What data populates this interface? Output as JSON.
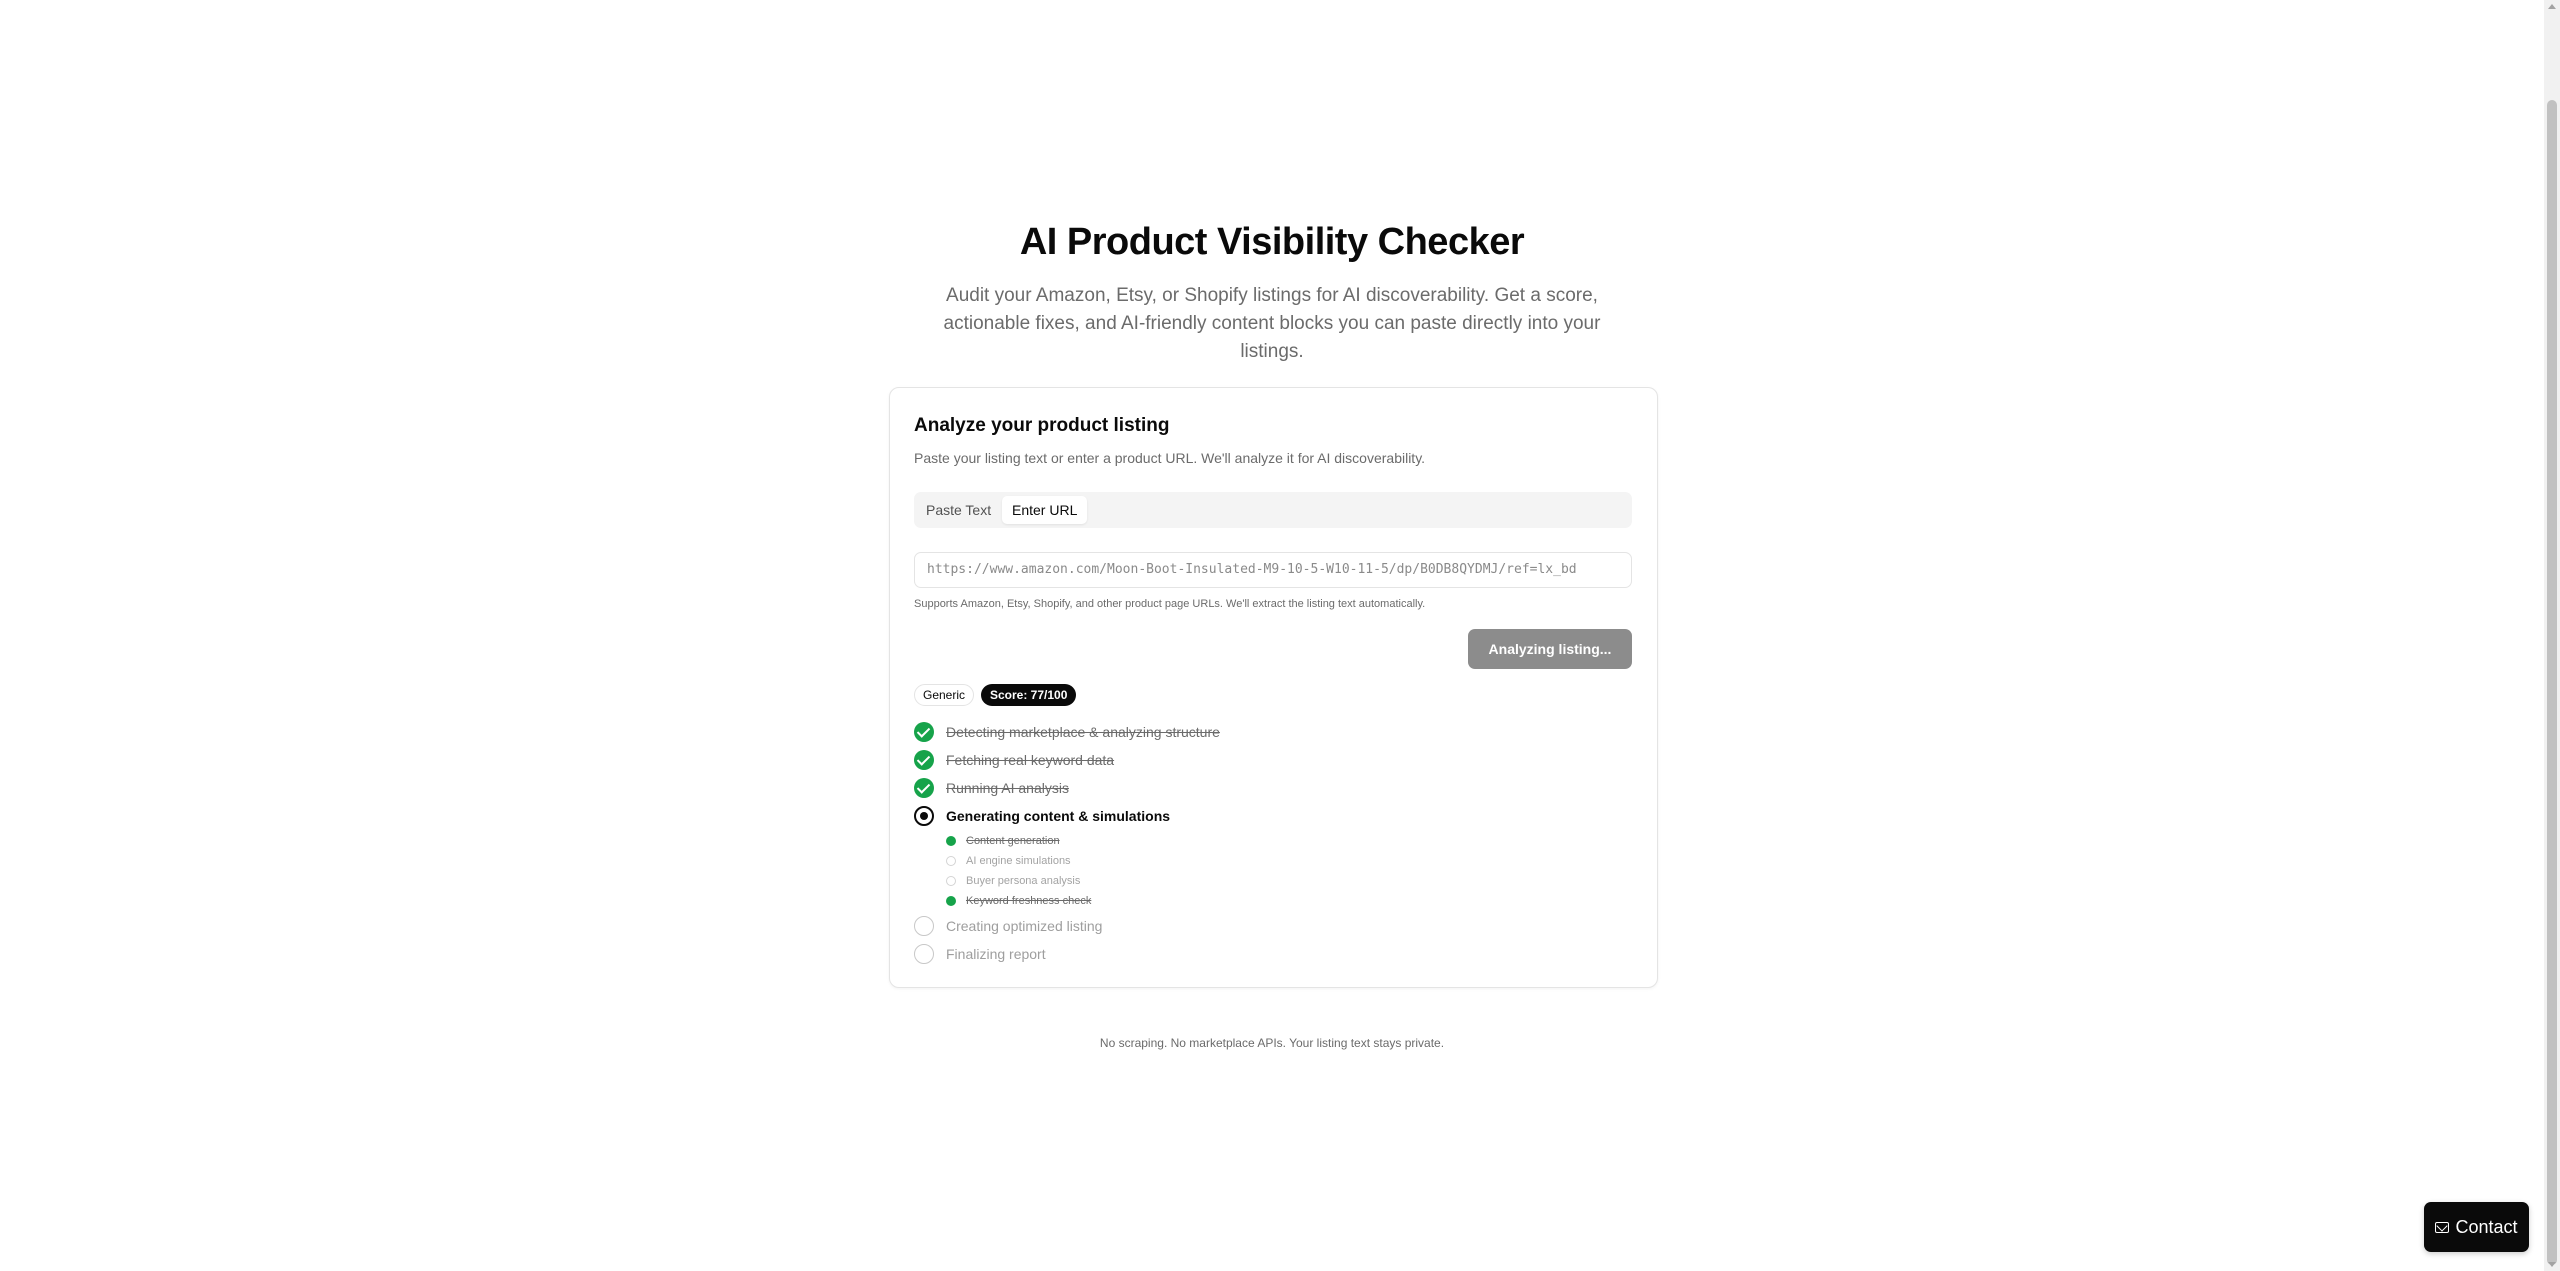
{
  "hero": {
    "title": "AI Product Visibility Checker",
    "subtitle": "Audit your Amazon, Etsy, or Shopify listings for AI discoverability. Get a score, actionable fixes, and AI-friendly content blocks you can paste directly into your listings."
  },
  "card": {
    "title": "Analyze your product listing",
    "description": "Paste your listing text or enter a product URL. We'll analyze it for AI discoverability.",
    "tabs": [
      {
        "label": "Paste Text",
        "active": false
      },
      {
        "label": "Enter URL",
        "active": true
      }
    ],
    "url_value": "https://www.amazon.com/Moon-Boot-Insulated-M9-10-5-W10-11-5/dp/B0DB8QYDMJ/ref=lx_bd",
    "helper": "Supports Amazon, Etsy, Shopify, and other product page URLs. We'll extract the listing text automatically.",
    "analyze_label": "Analyzing listing...",
    "badge_generic": "Generic",
    "badge_score": "Score: 77/100",
    "steps": [
      {
        "label": "Detecting marketplace & analyzing structure",
        "state": "done"
      },
      {
        "label": "Fetching real keyword data",
        "state": "done"
      },
      {
        "label": "Running AI analysis",
        "state": "done"
      },
      {
        "label": "Generating content & simulations",
        "state": "active"
      },
      {
        "label": "Creating optimized listing",
        "state": "pending"
      },
      {
        "label": "Finalizing report",
        "state": "pending"
      }
    ],
    "substeps": [
      {
        "label": "Content generation",
        "state": "done"
      },
      {
        "label": "AI engine simulations",
        "state": "pending"
      },
      {
        "label": "Buyer persona analysis",
        "state": "pending"
      },
      {
        "label": "Keyword freshness check",
        "state": "done"
      }
    ]
  },
  "footer_note": "No scraping. No marketplace APIs. Your listing text stays private.",
  "contact": {
    "label": "Contact",
    "icon": "mail-icon"
  },
  "colors": {
    "success": "#16a34a",
    "primary": "#0a0a0a",
    "disabled_button": "#8c8c8c"
  }
}
